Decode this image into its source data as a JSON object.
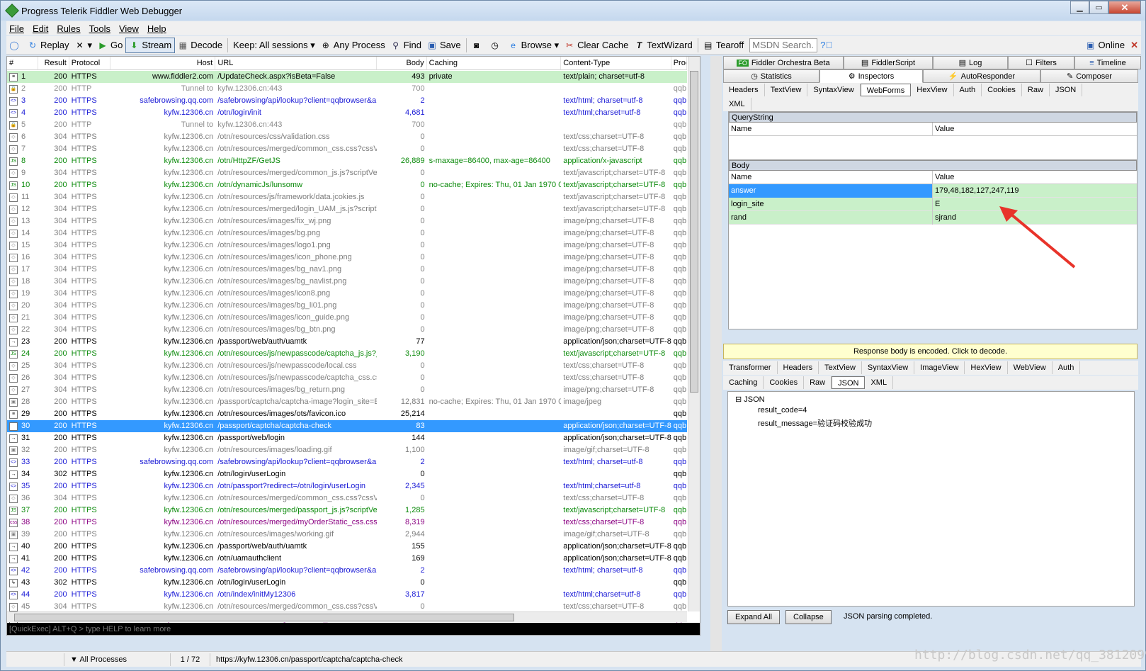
{
  "window": {
    "title": "Progress Telerik Fiddler Web Debugger"
  },
  "menu": [
    "File",
    "Edit",
    "Rules",
    "Tools",
    "View",
    "Help"
  ],
  "toolbar": {
    "replay": "Replay",
    "go": "Go",
    "stream": "Stream",
    "decode": "Decode",
    "keep": "Keep: All sessions",
    "any_process": "Any Process",
    "find": "Find",
    "save": "Save",
    "browse": "Browse",
    "clear_cache": "Clear Cache",
    "textwizard": "TextWizard",
    "tearoff": "Tearoff",
    "msdn_placeholder": "MSDN Search...",
    "online": "Online"
  },
  "sessions": {
    "columns": [
      "#",
      "Result",
      "Protocol",
      "Host",
      "URL",
      "Body",
      "Caching",
      "Content-Type",
      "Proc"
    ],
    "rows": [
      {
        "id": "1",
        "result": "200",
        "protocol": "HTTPS",
        "host": "www.fiddler2.com",
        "url": "/UpdateCheck.aspx?isBeta=False",
        "body": "493",
        "caching": "private",
        "ct": "text/plain; charset=utf-8",
        "proc": "",
        "kind": "k-first",
        "icon": "≡"
      },
      {
        "id": "2",
        "result": "200",
        "protocol": "HTTP",
        "host": "Tunnel to",
        "url": "kyfw.12306.cn:443",
        "body": "700",
        "caching": "",
        "ct": "",
        "proc": "qqb",
        "kind": "k-tunnel",
        "icon": "🔒"
      },
      {
        "id": "3",
        "result": "200",
        "protocol": "HTTPS",
        "host": "safebrowsing.qq.com",
        "url": "/safebrowsing/api/lookup?client=qqbrowser&app...",
        "body": "2",
        "caching": "",
        "ct": "text/html; charset=utf-8",
        "proc": "qqb",
        "kind": "k-blue",
        "icon": "<>"
      },
      {
        "id": "4",
        "result": "200",
        "protocol": "HTTPS",
        "host": "kyfw.12306.cn",
        "url": "/otn/login/init",
        "body": "4,681",
        "caching": "",
        "ct": "text/html;charset=utf-8",
        "proc": "qqb",
        "kind": "k-blue",
        "icon": "<>"
      },
      {
        "id": "5",
        "result": "200",
        "protocol": "HTTP",
        "host": "Tunnel to",
        "url": "kyfw.12306.cn:443",
        "body": "700",
        "caching": "",
        "ct": "",
        "proc": "qqb",
        "kind": "k-tunnel",
        "icon": "🔒"
      },
      {
        "id": "6",
        "result": "304",
        "protocol": "HTTPS",
        "host": "kyfw.12306.cn",
        "url": "/otn/resources/css/validation.css",
        "body": "0",
        "caching": "",
        "ct": "text/css;charset=UTF-8",
        "proc": "qqb",
        "kind": "k-cached",
        "icon": "◇"
      },
      {
        "id": "7",
        "result": "304",
        "protocol": "HTTPS",
        "host": "kyfw.12306.cn",
        "url": "/otn/resources/merged/common_css.css?cssVers...",
        "body": "0",
        "caching": "",
        "ct": "text/css;charset=UTF-8",
        "proc": "qqb",
        "kind": "k-cached",
        "icon": "◇"
      },
      {
        "id": "8",
        "result": "200",
        "protocol": "HTTPS",
        "host": "kyfw.12306.cn",
        "url": "/otn/HttpZF/GetJS",
        "body": "26,889",
        "caching": "s-maxage=86400, max-age=86400",
        "ct": "application/x-javascript",
        "proc": "qqb",
        "kind": "k-green",
        "icon": "JS"
      },
      {
        "id": "9",
        "result": "304",
        "protocol": "HTTPS",
        "host": "kyfw.12306.cn",
        "url": "/otn/resources/merged/common_js.js?scriptVersi...",
        "body": "0",
        "caching": "",
        "ct": "text/javascript;charset=UTF-8",
        "proc": "qqb",
        "kind": "k-cached",
        "icon": "◇"
      },
      {
        "id": "10",
        "result": "200",
        "protocol": "HTTPS",
        "host": "kyfw.12306.cn",
        "url": "/otn/dynamicJs/lunsomw",
        "body": "0",
        "caching": "no-cache; Expires: Thu, 01 Jan 1970 0...",
        "ct": "text/javascript;charset=UTF-8",
        "proc": "qqb",
        "kind": "k-green",
        "icon": "JS"
      },
      {
        "id": "11",
        "result": "304",
        "protocol": "HTTPS",
        "host": "kyfw.12306.cn",
        "url": "/otn/resources/js/framework/data.jcokies.js",
        "body": "0",
        "caching": "",
        "ct": "text/javascript;charset=UTF-8",
        "proc": "qqb",
        "kind": "k-cached",
        "icon": "◇"
      },
      {
        "id": "12",
        "result": "304",
        "protocol": "HTTPS",
        "host": "kyfw.12306.cn",
        "url": "/otn/resources/merged/login_UAM_js.js?scriptVe...",
        "body": "0",
        "caching": "",
        "ct": "text/javascript;charset=UTF-8",
        "proc": "qqb",
        "kind": "k-cached",
        "icon": "◇"
      },
      {
        "id": "13",
        "result": "304",
        "protocol": "HTTPS",
        "host": "kyfw.12306.cn",
        "url": "/otn/resources/images/fix_wj.png",
        "body": "0",
        "caching": "",
        "ct": "image/png;charset=UTF-8",
        "proc": "qqb",
        "kind": "k-cached",
        "icon": "◇"
      },
      {
        "id": "14",
        "result": "304",
        "protocol": "HTTPS",
        "host": "kyfw.12306.cn",
        "url": "/otn/resources/images/bg.png",
        "body": "0",
        "caching": "",
        "ct": "image/png;charset=UTF-8",
        "proc": "qqb",
        "kind": "k-cached",
        "icon": "◇"
      },
      {
        "id": "15",
        "result": "304",
        "protocol": "HTTPS",
        "host": "kyfw.12306.cn",
        "url": "/otn/resources/images/logo1.png",
        "body": "0",
        "caching": "",
        "ct": "image/png;charset=UTF-8",
        "proc": "qqb",
        "kind": "k-cached",
        "icon": "◇"
      },
      {
        "id": "16",
        "result": "304",
        "protocol": "HTTPS",
        "host": "kyfw.12306.cn",
        "url": "/otn/resources/images/icon_phone.png",
        "body": "0",
        "caching": "",
        "ct": "image/png;charset=UTF-8",
        "proc": "qqb",
        "kind": "k-cached",
        "icon": "◇"
      },
      {
        "id": "17",
        "result": "304",
        "protocol": "HTTPS",
        "host": "kyfw.12306.cn",
        "url": "/otn/resources/images/bg_nav1.png",
        "body": "0",
        "caching": "",
        "ct": "image/png;charset=UTF-8",
        "proc": "qqb",
        "kind": "k-cached",
        "icon": "◇"
      },
      {
        "id": "18",
        "result": "304",
        "protocol": "HTTPS",
        "host": "kyfw.12306.cn",
        "url": "/otn/resources/images/bg_navlist.png",
        "body": "0",
        "caching": "",
        "ct": "image/png;charset=UTF-8",
        "proc": "qqb",
        "kind": "k-cached",
        "icon": "◇"
      },
      {
        "id": "19",
        "result": "304",
        "protocol": "HTTPS",
        "host": "kyfw.12306.cn",
        "url": "/otn/resources/images/icon8.png",
        "body": "0",
        "caching": "",
        "ct": "image/png;charset=UTF-8",
        "proc": "qqb",
        "kind": "k-cached",
        "icon": "◇"
      },
      {
        "id": "20",
        "result": "304",
        "protocol": "HTTPS",
        "host": "kyfw.12306.cn",
        "url": "/otn/resources/images/bg_li01.png",
        "body": "0",
        "caching": "",
        "ct": "image/png;charset=UTF-8",
        "proc": "qqb",
        "kind": "k-cached",
        "icon": "◇"
      },
      {
        "id": "21",
        "result": "304",
        "protocol": "HTTPS",
        "host": "kyfw.12306.cn",
        "url": "/otn/resources/images/icon_guide.png",
        "body": "0",
        "caching": "",
        "ct": "image/png;charset=UTF-8",
        "proc": "qqb",
        "kind": "k-cached",
        "icon": "◇"
      },
      {
        "id": "22",
        "result": "304",
        "protocol": "HTTPS",
        "host": "kyfw.12306.cn",
        "url": "/otn/resources/images/bg_btn.png",
        "body": "0",
        "caching": "",
        "ct": "image/png;charset=UTF-8",
        "proc": "qqb",
        "kind": "k-cached",
        "icon": "◇"
      },
      {
        "id": "23",
        "result": "200",
        "protocol": "HTTPS",
        "host": "kyfw.12306.cn",
        "url": "/passport/web/auth/uamtk",
        "body": "77",
        "caching": "",
        "ct": "application/json;charset=UTF-8",
        "proc": "qqb",
        "kind": "k-ok",
        "icon": "→"
      },
      {
        "id": "24",
        "result": "200",
        "protocol": "HTTPS",
        "host": "kyfw.12306.cn",
        "url": "/otn/resources/js/newpasscode/captcha_js.js?_...",
        "body": "3,190",
        "caching": "",
        "ct": "text/javascript;charset=UTF-8",
        "proc": "qqb",
        "kind": "k-green",
        "icon": "JS"
      },
      {
        "id": "25",
        "result": "304",
        "protocol": "HTTPS",
        "host": "kyfw.12306.cn",
        "url": "/otn/resources/js/newpasscode/local.css",
        "body": "0",
        "caching": "",
        "ct": "text/css;charset=UTF-8",
        "proc": "qqb",
        "kind": "k-cached",
        "icon": "◇"
      },
      {
        "id": "26",
        "result": "304",
        "protocol": "HTTPS",
        "host": "kyfw.12306.cn",
        "url": "/otn/resources/js/newpasscode/captcha_css.css",
        "body": "0",
        "caching": "",
        "ct": "text/css;charset=UTF-8",
        "proc": "qqb",
        "kind": "k-cached",
        "icon": "◇"
      },
      {
        "id": "27",
        "result": "304",
        "protocol": "HTTPS",
        "host": "kyfw.12306.cn",
        "url": "/otn/resources/images/bg_return.png",
        "body": "0",
        "caching": "",
        "ct": "image/png;charset=UTF-8",
        "proc": "qqb",
        "kind": "k-cached",
        "icon": "◇"
      },
      {
        "id": "28",
        "result": "200",
        "protocol": "HTTPS",
        "host": "kyfw.12306.cn",
        "url": "/passport/captcha/captcha-image?login_site=E&...",
        "body": "12,831",
        "caching": "no-cache; Expires: Thu, 01 Jan 1970 0...",
        "ct": "image/jpeg",
        "proc": "qqb",
        "kind": "k-cached",
        "icon": "▣"
      },
      {
        "id": "29",
        "result": "200",
        "protocol": "HTTPS",
        "host": "kyfw.12306.cn",
        "url": "/otn/resources/images/ots/favicon.ico",
        "body": "25,214",
        "caching": "",
        "ct": "",
        "proc": "qqb",
        "kind": "k-ok",
        "icon": "≡"
      },
      {
        "id": "30",
        "result": "200",
        "protocol": "HTTPS",
        "host": "kyfw.12306.cn",
        "url": "/passport/captcha/captcha-check",
        "body": "83",
        "caching": "",
        "ct": "application/json;charset=UTF-8",
        "proc": "qqb",
        "kind": "k-selected",
        "icon": "→"
      },
      {
        "id": "31",
        "result": "200",
        "protocol": "HTTPS",
        "host": "kyfw.12306.cn",
        "url": "/passport/web/login",
        "body": "144",
        "caching": "",
        "ct": "application/json;charset=UTF-8",
        "proc": "qqb",
        "kind": "k-ok",
        "icon": "→"
      },
      {
        "id": "32",
        "result": "200",
        "protocol": "HTTPS",
        "host": "kyfw.12306.cn",
        "url": "/otn/resources/images/loading.gif",
        "body": "1,100",
        "caching": "",
        "ct": "image/gif;charset=UTF-8",
        "proc": "qqb",
        "kind": "k-cached",
        "icon": "▣"
      },
      {
        "id": "33",
        "result": "200",
        "protocol": "HTTPS",
        "host": "safebrowsing.qq.com",
        "url": "/safebrowsing/api/lookup?client=qqbrowser&app...",
        "body": "2",
        "caching": "",
        "ct": "text/html; charset=utf-8",
        "proc": "qqb",
        "kind": "k-blue",
        "icon": "<>"
      },
      {
        "id": "34",
        "result": "302",
        "protocol": "HTTPS",
        "host": "kyfw.12306.cn",
        "url": "/otn/login/userLogin",
        "body": "0",
        "caching": "",
        "ct": "",
        "proc": "qqb",
        "kind": "k-ok",
        "icon": "→"
      },
      {
        "id": "35",
        "result": "200",
        "protocol": "HTTPS",
        "host": "kyfw.12306.cn",
        "url": "/otn/passport?redirect=/otn/login/userLogin",
        "body": "2,345",
        "caching": "",
        "ct": "text/html;charset=utf-8",
        "proc": "qqb",
        "kind": "k-blue",
        "icon": "<>"
      },
      {
        "id": "36",
        "result": "304",
        "protocol": "HTTPS",
        "host": "kyfw.12306.cn",
        "url": "/otn/resources/merged/common_css.css?cssVers...",
        "body": "0",
        "caching": "",
        "ct": "text/css;charset=UTF-8",
        "proc": "qqb",
        "kind": "k-cached",
        "icon": "◇"
      },
      {
        "id": "37",
        "result": "200",
        "protocol": "HTTPS",
        "host": "kyfw.12306.cn",
        "url": "/otn/resources/merged/passport_js.js?scriptVers...",
        "body": "1,285",
        "caching": "",
        "ct": "text/javascript;charset=UTF-8",
        "proc": "qqb",
        "kind": "k-green",
        "icon": "JS"
      },
      {
        "id": "38",
        "result": "200",
        "protocol": "HTTPS",
        "host": "kyfw.12306.cn",
        "url": "/otn/resources/merged/myOrderStatic_css.css?c...",
        "body": "8,319",
        "caching": "",
        "ct": "text/css;charset=UTF-8",
        "proc": "qqb",
        "kind": "k-purple",
        "icon": "css"
      },
      {
        "id": "39",
        "result": "200",
        "protocol": "HTTPS",
        "host": "kyfw.12306.cn",
        "url": "/otn/resources/images/working.gif",
        "body": "2,944",
        "caching": "",
        "ct": "image/gif;charset=UTF-8",
        "proc": "qqb",
        "kind": "k-cached",
        "icon": "▣"
      },
      {
        "id": "40",
        "result": "200",
        "protocol": "HTTPS",
        "host": "kyfw.12306.cn",
        "url": "/passport/web/auth/uamtk",
        "body": "155",
        "caching": "",
        "ct": "application/json;charset=UTF-8",
        "proc": "qqb",
        "kind": "k-ok",
        "icon": "→"
      },
      {
        "id": "41",
        "result": "200",
        "protocol": "HTTPS",
        "host": "kyfw.12306.cn",
        "url": "/otn/uamauthclient",
        "body": "169",
        "caching": "",
        "ct": "application/json;charset=UTF-8",
        "proc": "qqb",
        "kind": "k-ok",
        "icon": "→"
      },
      {
        "id": "42",
        "result": "200",
        "protocol": "HTTPS",
        "host": "safebrowsing.qq.com",
        "url": "/safebrowsing/api/lookup?client=qqbrowser&app...",
        "body": "2",
        "caching": "",
        "ct": "text/html; charset=utf-8",
        "proc": "qqb",
        "kind": "k-blue",
        "icon": "<>"
      },
      {
        "id": "43",
        "result": "302",
        "protocol": "HTTPS",
        "host": "kyfw.12306.cn",
        "url": "/otn/login/userLogin",
        "body": "0",
        "caching": "",
        "ct": "",
        "proc": "qqb",
        "kind": "k-ok",
        "icon": "↳"
      },
      {
        "id": "44",
        "result": "200",
        "protocol": "HTTPS",
        "host": "kyfw.12306.cn",
        "url": "/otn/index/initMy12306",
        "body": "3,817",
        "caching": "",
        "ct": "text/html;charset=utf-8",
        "proc": "qqb",
        "kind": "k-blue",
        "icon": "<>"
      },
      {
        "id": "45",
        "result": "304",
        "protocol": "HTTPS",
        "host": "kyfw.12306.cn",
        "url": "/otn/resources/merged/common_css.css?cssVers...",
        "body": "0",
        "caching": "",
        "ct": "text/css;charset=UTF-8",
        "proc": "qqb",
        "kind": "k-cached",
        "icon": "◇"
      },
      {
        "id": "46",
        "result": "200",
        "protocol": "HTTPS",
        "host": "kyfw.12306.cn",
        "url": "/otn/resources/merged/sidebar_css.css?cssVersi...",
        "body": "13,752",
        "caching": "",
        "ct": "text/css;charset=UTF-8",
        "proc": "qqb",
        "kind": "k-purple",
        "icon": "css"
      }
    ]
  },
  "quickexec": "[QuickExec] ALT+Q > type HELP to learn more",
  "status": {
    "processes": "All Processes",
    "count": "1 / 72",
    "url": "https://kyfw.12306.cn/passport/captcha/captcha-check"
  },
  "tabs_top": [
    "Fiddler Orchestra Beta",
    "FiddlerScript",
    "Log",
    "Filters",
    "Timeline"
  ],
  "tabs_second": [
    "Statistics",
    "Inspectors",
    "AutoResponder",
    "Composer"
  ],
  "req_subtabs": [
    "Headers",
    "TextView",
    "SyntaxView",
    "WebForms",
    "HexView",
    "Auth",
    "Cookies",
    "Raw",
    "JSON"
  ],
  "req_subtab_xml": "XML",
  "querystring": {
    "title": "QueryString",
    "name_col": "Name",
    "value_col": "Value"
  },
  "body": {
    "title": "Body",
    "name_col": "Name",
    "value_col": "Value",
    "rows": [
      {
        "name": "answer",
        "value": "179,48,182,127,247,119"
      },
      {
        "name": "login_site",
        "value": "E"
      },
      {
        "name": "rand",
        "value": "sjrand"
      }
    ]
  },
  "encoded_notice": "Response body is encoded. Click to decode.",
  "resp_subtabs_1": [
    "Transformer",
    "Headers",
    "TextView",
    "SyntaxView",
    "ImageView",
    "HexView",
    "WebView",
    "Auth"
  ],
  "resp_subtabs_2": [
    "Caching",
    "Cookies",
    "Raw",
    "JSON",
    "XML"
  ],
  "json_tree": {
    "root": "JSON",
    "items": [
      "result_code=4",
      "result_message=验证码校验成功"
    ]
  },
  "buttons": {
    "expand_all": "Expand All",
    "collapse": "Collapse",
    "status": "JSON parsing completed."
  },
  "watermark": "http://blog.csdn.net/qq_38120990",
  "colors": {
    "selected": "#3399ff",
    "green_row": "#c9f0c9",
    "arrow": "#e8332a"
  }
}
